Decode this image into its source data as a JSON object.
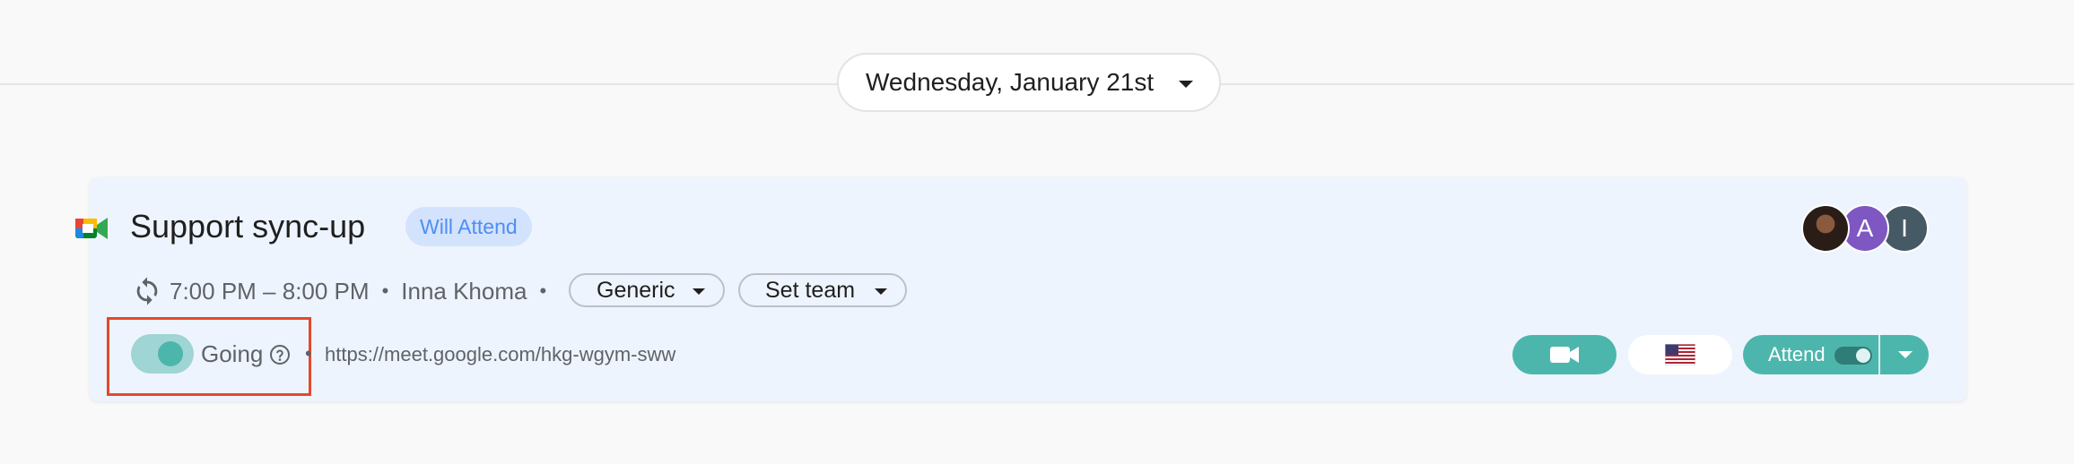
{
  "date_selector": {
    "label": "Wednesday, January 21st"
  },
  "event": {
    "title": "Support sync-up",
    "status_badge": "Will Attend",
    "time_range": "7:00 PM – 8:00 PM",
    "separator": "•",
    "organizer": "Inna Khoma",
    "category_chip": "Generic",
    "team_chip": "Set team",
    "going_label": "Going",
    "meet_url": "https://meet.google.com/hkg-wgym-sww",
    "attend_label": "Attend",
    "going_toggle_on": true,
    "attend_toggle_on": true
  },
  "attendees": [
    {
      "type": "photo",
      "initial": ""
    },
    {
      "type": "initial",
      "initial": "A",
      "color": "#7e57c2"
    },
    {
      "type": "initial",
      "initial": "I",
      "color": "#455a64"
    }
  ],
  "icons": {
    "app_logo": "google-meet-icon",
    "recurrence": "repeat-icon",
    "help": "help-circle-icon",
    "video": "video-camera-icon",
    "language": "us-flag-icon",
    "dropdown": "chevron-down-icon"
  },
  "colors": {
    "accent_teal": "#4db6ac",
    "badge_bg": "#d3e3fd",
    "badge_text": "#4f8df5",
    "card_bg": "#eef4fd",
    "highlight": "#e4472c"
  }
}
